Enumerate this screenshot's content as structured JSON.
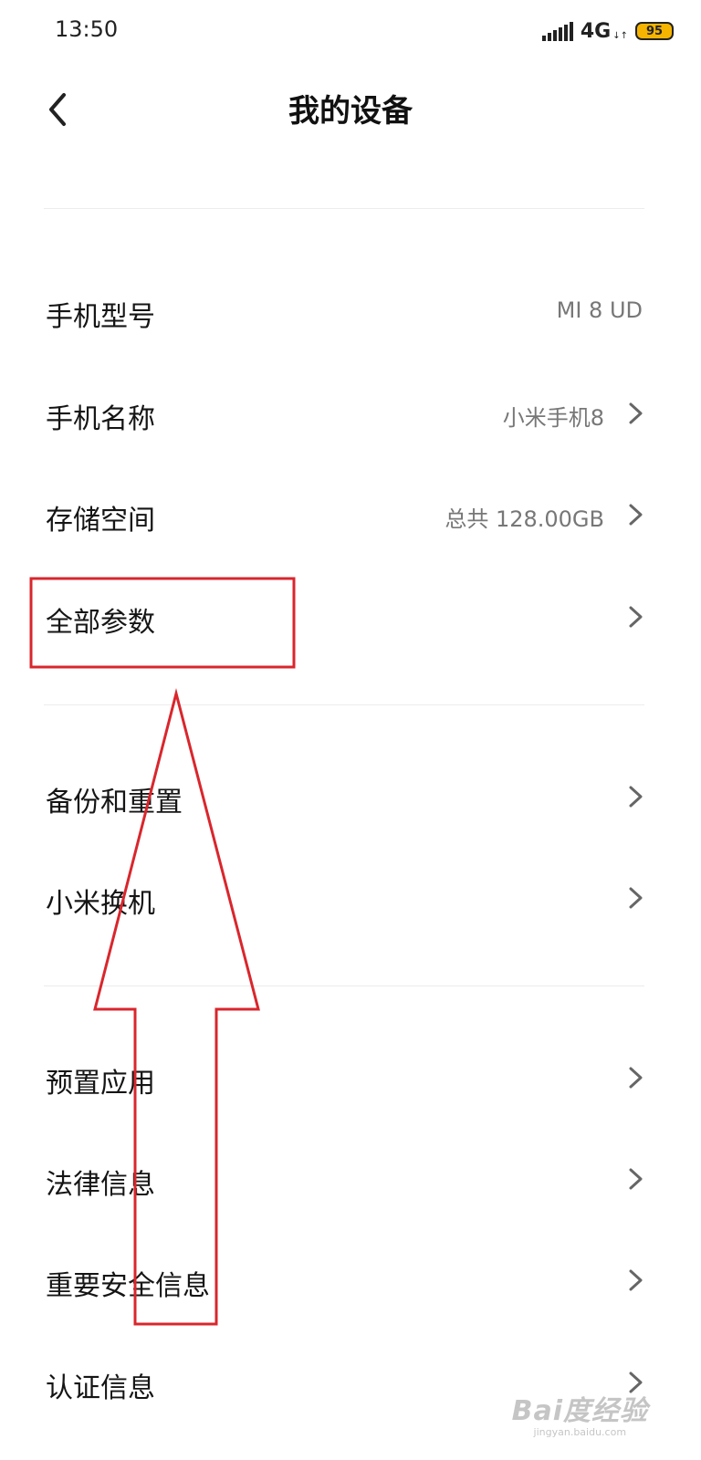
{
  "status_bar": {
    "time": "13:50",
    "network": "4G",
    "battery": "95"
  },
  "header": {
    "title": "我的设备"
  },
  "items": [
    {
      "label": "手机型号",
      "value": "MI 8 UD"
    },
    {
      "label": "手机名称",
      "value": "小米手机8"
    },
    {
      "label": "存储空间",
      "value": "总共 128.00GB"
    },
    {
      "label": "全部参数",
      "value": ""
    },
    {
      "label": "备份和重置",
      "value": ""
    },
    {
      "label": "小米换机",
      "value": ""
    },
    {
      "label": "预置应用",
      "value": ""
    },
    {
      "label": "法律信息",
      "value": ""
    },
    {
      "label": "重要安全信息",
      "value": ""
    },
    {
      "label": "认证信息",
      "value": ""
    }
  ],
  "watermark": {
    "brand": "Bai度经验",
    "url": "jingyan.baidu.com"
  },
  "colors": {
    "annotation": "#d9262c",
    "battery": "#f5b400",
    "divider": "#ececec",
    "secondary_text": "#777777"
  }
}
